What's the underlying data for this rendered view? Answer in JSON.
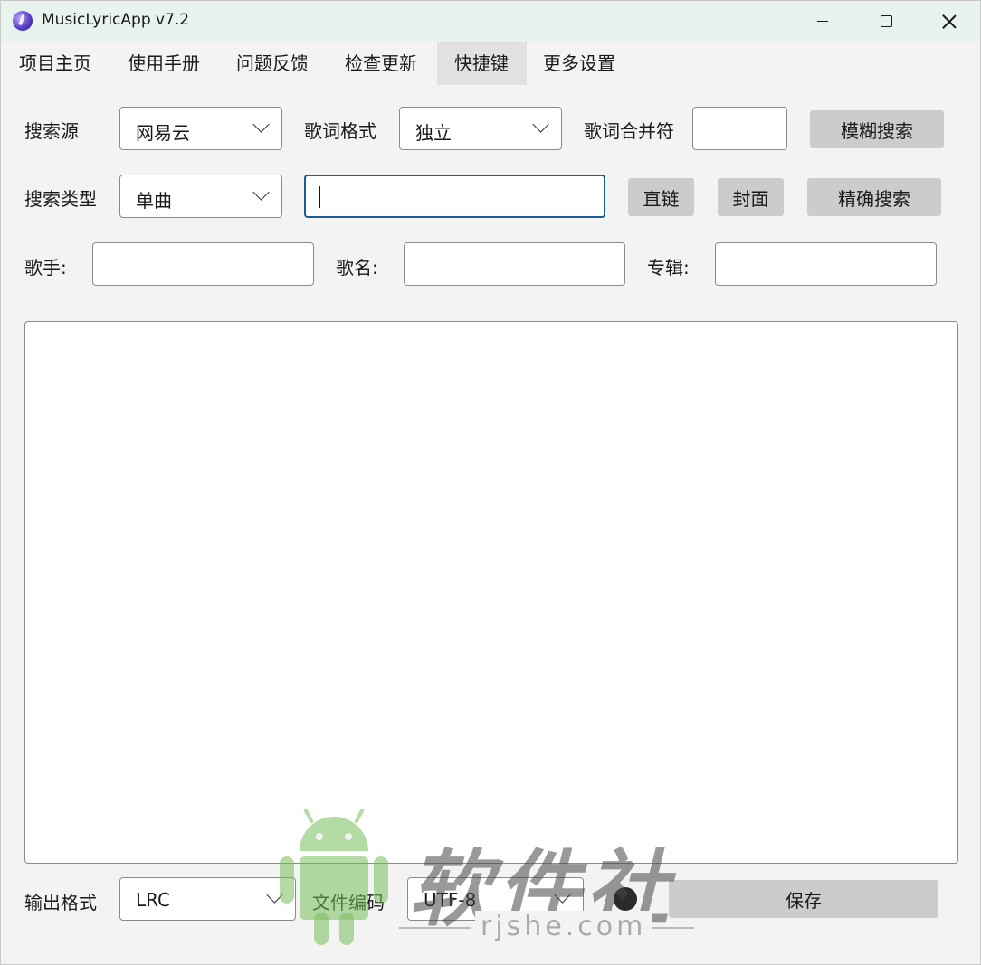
{
  "window": {
    "title": "MusicLyricApp v7.2",
    "controls": {
      "minimize": "minimize-icon",
      "maximize": "maximize-icon",
      "close": "close-icon"
    }
  },
  "menu": [
    {
      "label": "项目主页"
    },
    {
      "label": "使用手册"
    },
    {
      "label": "问题反馈"
    },
    {
      "label": "检查更新"
    },
    {
      "label": "快捷键",
      "active": true
    },
    {
      "label": "更多设置"
    }
  ],
  "search": {
    "source_label": "搜索源",
    "source_value": "网易云",
    "format_label": "歌词格式",
    "format_value": "独立",
    "merge_label": "歌词合并符",
    "merge_value": "",
    "fuzzy_button": "模糊搜索",
    "type_label": "搜索类型",
    "type_value": "单曲",
    "query_value": "",
    "direct_link_button": "直链",
    "cover_button": "封面",
    "exact_button": "精确搜索",
    "singer_label": "歌手:",
    "song_label": "歌名:",
    "album_label": "专辑:"
  },
  "output": {
    "format_label": "输出格式",
    "format_value": "LRC",
    "encoding_label": "文件编码",
    "encoding_value": "UTF-8",
    "save_button": "保存"
  },
  "watermark": {
    "text": "软件社",
    "url": "rjshe.com"
  },
  "colors": {
    "titlebar": "#e9f3ee",
    "focus_border": "#1d5c9c",
    "button": "#cccccc",
    "menu_active": "#e1e1e1"
  }
}
